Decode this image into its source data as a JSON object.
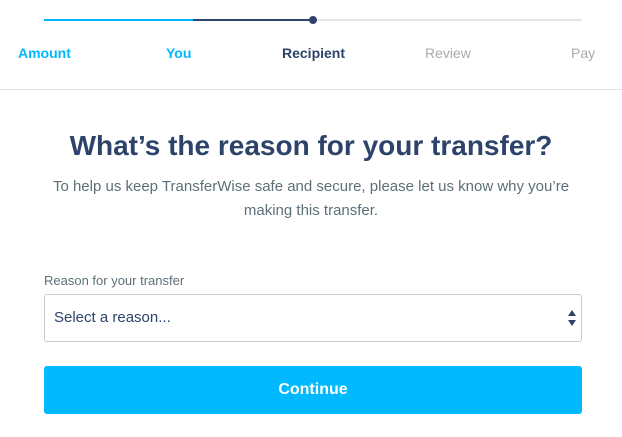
{
  "stepper": {
    "steps": [
      {
        "label": "Amount",
        "state": "done"
      },
      {
        "label": "You",
        "state": "done"
      },
      {
        "label": "Recipient",
        "state": "active"
      },
      {
        "label": "Review",
        "state": "todo"
      },
      {
        "label": "Pay",
        "state": "todo"
      }
    ]
  },
  "main": {
    "title": "What’s the reason for your transfer?",
    "subtitle": "To help us keep TransferWise safe and secure, please let us know why you’re making this transfer."
  },
  "form": {
    "reason_label": "Reason for your transfer",
    "reason_value": "Select a reason...",
    "continue_label": "Continue"
  },
  "colors": {
    "accent": "#00b9ff",
    "navy": "#2e4369",
    "muted": "#a8aaac"
  }
}
